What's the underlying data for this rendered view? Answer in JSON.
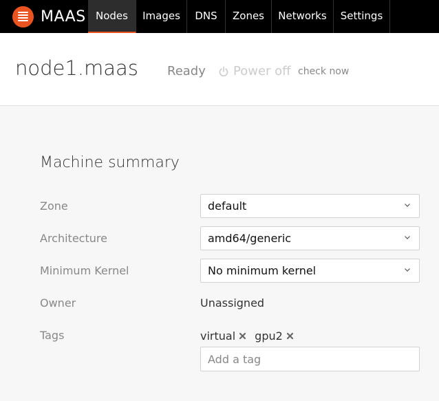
{
  "app": {
    "name": "MAAS",
    "accent": "#e95420"
  },
  "nav": [
    {
      "label": "Nodes",
      "active": true
    },
    {
      "label": "Images",
      "active": false
    },
    {
      "label": "DNS",
      "active": false
    },
    {
      "label": "Zones",
      "active": false
    },
    {
      "label": "Networks",
      "active": false
    },
    {
      "label": "Settings",
      "active": false
    }
  ],
  "header": {
    "node_name": "node1.maas",
    "status": "Ready",
    "power_state": "Power off",
    "power_icon": "power-icon",
    "check_now": "check now"
  },
  "summary": {
    "title": "Machine summary",
    "zone": {
      "label": "Zone",
      "value": "default"
    },
    "architecture": {
      "label": "Architecture",
      "value": "amd64/generic"
    },
    "min_kernel": {
      "label": "Minimum Kernel",
      "value": "No minimum kernel"
    },
    "owner": {
      "label": "Owner",
      "value": "Unassigned"
    },
    "tags": {
      "label": "Tags",
      "items": [
        "virtual",
        "gpu2"
      ],
      "placeholder": "Add a tag"
    }
  }
}
